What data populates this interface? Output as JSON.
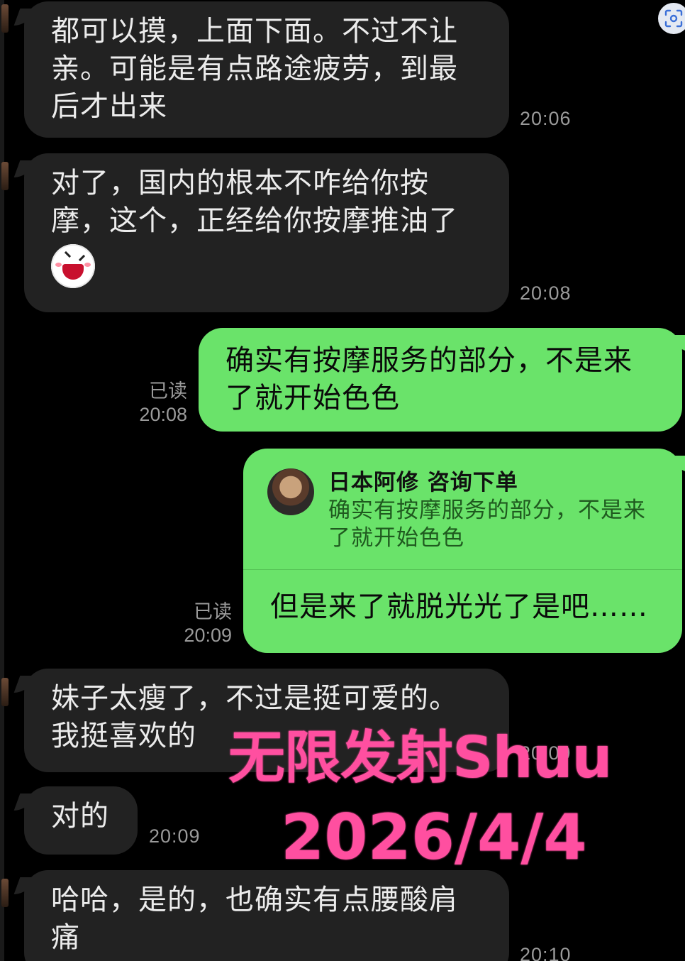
{
  "messages": [
    {
      "side": "in",
      "text": "都可以摸，上面下面。不过不让\n亲。可能是有点路途疲劳，到最\n后才出来",
      "time": "20:06"
    },
    {
      "side": "in",
      "text": "对了，国内的根本不咋给你按\n摩，这个，正经给你按摩推油了",
      "emoji": "laughing-face-sticker",
      "time": "20:08"
    },
    {
      "side": "out",
      "text": "确实有按摩服务的部分，不是来\n了就开始色色",
      "read": "已读",
      "time": "20:08"
    },
    {
      "side": "out",
      "quote_name": "日本阿修 咨询下单",
      "quote_text": "确实有按摩服务的部分，不是来\n了就开始色色",
      "text": "但是来了就脱光光了是吧……",
      "read": "已读",
      "time": "20:09"
    },
    {
      "side": "in",
      "text": "妹子太瘦了，不过是挺可爱的。\n我挺喜欢的",
      "time": "20:09"
    },
    {
      "side": "in",
      "text": "对的",
      "time": "20:09"
    },
    {
      "side": "in",
      "text": "哈哈，是的，也确实有点腰酸肩\n痛",
      "time": "20:10"
    }
  ],
  "watermark": {
    "line1": "无限发射Shuu",
    "line2": "2026/4/4",
    "color": "#ff4fa0"
  },
  "colors": {
    "background": "#000000",
    "incoming_bubble": "#222222",
    "outgoing_bubble": "#6ae36a",
    "timestamp": "#9a9a9a"
  },
  "icons": {
    "corner": "scan-icon"
  }
}
